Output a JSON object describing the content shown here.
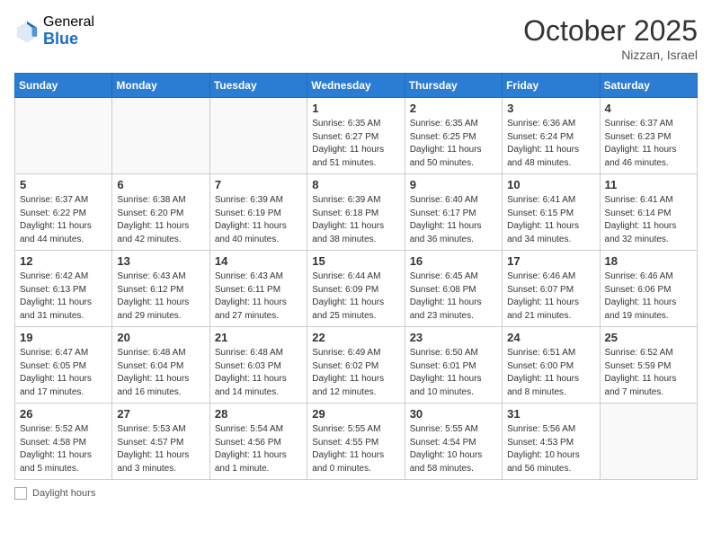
{
  "header": {
    "logo_general": "General",
    "logo_blue": "Blue",
    "month_title": "October 2025",
    "location": "Nizzan, Israel"
  },
  "weekdays": [
    "Sunday",
    "Monday",
    "Tuesday",
    "Wednesday",
    "Thursday",
    "Friday",
    "Saturday"
  ],
  "weeks": [
    [
      {
        "day": "",
        "info": ""
      },
      {
        "day": "",
        "info": ""
      },
      {
        "day": "",
        "info": ""
      },
      {
        "day": "1",
        "info": "Sunrise: 6:35 AM\nSunset: 6:27 PM\nDaylight: 11 hours and 51 minutes."
      },
      {
        "day": "2",
        "info": "Sunrise: 6:35 AM\nSunset: 6:25 PM\nDaylight: 11 hours and 50 minutes."
      },
      {
        "day": "3",
        "info": "Sunrise: 6:36 AM\nSunset: 6:24 PM\nDaylight: 11 hours and 48 minutes."
      },
      {
        "day": "4",
        "info": "Sunrise: 6:37 AM\nSunset: 6:23 PM\nDaylight: 11 hours and 46 minutes."
      }
    ],
    [
      {
        "day": "5",
        "info": "Sunrise: 6:37 AM\nSunset: 6:22 PM\nDaylight: 11 hours and 44 minutes."
      },
      {
        "day": "6",
        "info": "Sunrise: 6:38 AM\nSunset: 6:20 PM\nDaylight: 11 hours and 42 minutes."
      },
      {
        "day": "7",
        "info": "Sunrise: 6:39 AM\nSunset: 6:19 PM\nDaylight: 11 hours and 40 minutes."
      },
      {
        "day": "8",
        "info": "Sunrise: 6:39 AM\nSunset: 6:18 PM\nDaylight: 11 hours and 38 minutes."
      },
      {
        "day": "9",
        "info": "Sunrise: 6:40 AM\nSunset: 6:17 PM\nDaylight: 11 hours and 36 minutes."
      },
      {
        "day": "10",
        "info": "Sunrise: 6:41 AM\nSunset: 6:15 PM\nDaylight: 11 hours and 34 minutes."
      },
      {
        "day": "11",
        "info": "Sunrise: 6:41 AM\nSunset: 6:14 PM\nDaylight: 11 hours and 32 minutes."
      }
    ],
    [
      {
        "day": "12",
        "info": "Sunrise: 6:42 AM\nSunset: 6:13 PM\nDaylight: 11 hours and 31 minutes."
      },
      {
        "day": "13",
        "info": "Sunrise: 6:43 AM\nSunset: 6:12 PM\nDaylight: 11 hours and 29 minutes."
      },
      {
        "day": "14",
        "info": "Sunrise: 6:43 AM\nSunset: 6:11 PM\nDaylight: 11 hours and 27 minutes."
      },
      {
        "day": "15",
        "info": "Sunrise: 6:44 AM\nSunset: 6:09 PM\nDaylight: 11 hours and 25 minutes."
      },
      {
        "day": "16",
        "info": "Sunrise: 6:45 AM\nSunset: 6:08 PM\nDaylight: 11 hours and 23 minutes."
      },
      {
        "day": "17",
        "info": "Sunrise: 6:46 AM\nSunset: 6:07 PM\nDaylight: 11 hours and 21 minutes."
      },
      {
        "day": "18",
        "info": "Sunrise: 6:46 AM\nSunset: 6:06 PM\nDaylight: 11 hours and 19 minutes."
      }
    ],
    [
      {
        "day": "19",
        "info": "Sunrise: 6:47 AM\nSunset: 6:05 PM\nDaylight: 11 hours and 17 minutes."
      },
      {
        "day": "20",
        "info": "Sunrise: 6:48 AM\nSunset: 6:04 PM\nDaylight: 11 hours and 16 minutes."
      },
      {
        "day": "21",
        "info": "Sunrise: 6:48 AM\nSunset: 6:03 PM\nDaylight: 11 hours and 14 minutes."
      },
      {
        "day": "22",
        "info": "Sunrise: 6:49 AM\nSunset: 6:02 PM\nDaylight: 11 hours and 12 minutes."
      },
      {
        "day": "23",
        "info": "Sunrise: 6:50 AM\nSunset: 6:01 PM\nDaylight: 11 hours and 10 minutes."
      },
      {
        "day": "24",
        "info": "Sunrise: 6:51 AM\nSunset: 6:00 PM\nDaylight: 11 hours and 8 minutes."
      },
      {
        "day": "25",
        "info": "Sunrise: 6:52 AM\nSunset: 5:59 PM\nDaylight: 11 hours and 7 minutes."
      }
    ],
    [
      {
        "day": "26",
        "info": "Sunrise: 5:52 AM\nSunset: 4:58 PM\nDaylight: 11 hours and 5 minutes."
      },
      {
        "day": "27",
        "info": "Sunrise: 5:53 AM\nSunset: 4:57 PM\nDaylight: 11 hours and 3 minutes."
      },
      {
        "day": "28",
        "info": "Sunrise: 5:54 AM\nSunset: 4:56 PM\nDaylight: 11 hours and 1 minute."
      },
      {
        "day": "29",
        "info": "Sunrise: 5:55 AM\nSunset: 4:55 PM\nDaylight: 11 hours and 0 minutes."
      },
      {
        "day": "30",
        "info": "Sunrise: 5:55 AM\nSunset: 4:54 PM\nDaylight: 10 hours and 58 minutes."
      },
      {
        "day": "31",
        "info": "Sunrise: 5:56 AM\nSunset: 4:53 PM\nDaylight: 10 hours and 56 minutes."
      },
      {
        "day": "",
        "info": ""
      }
    ]
  ],
  "footer": {
    "label": "Daylight hours"
  }
}
